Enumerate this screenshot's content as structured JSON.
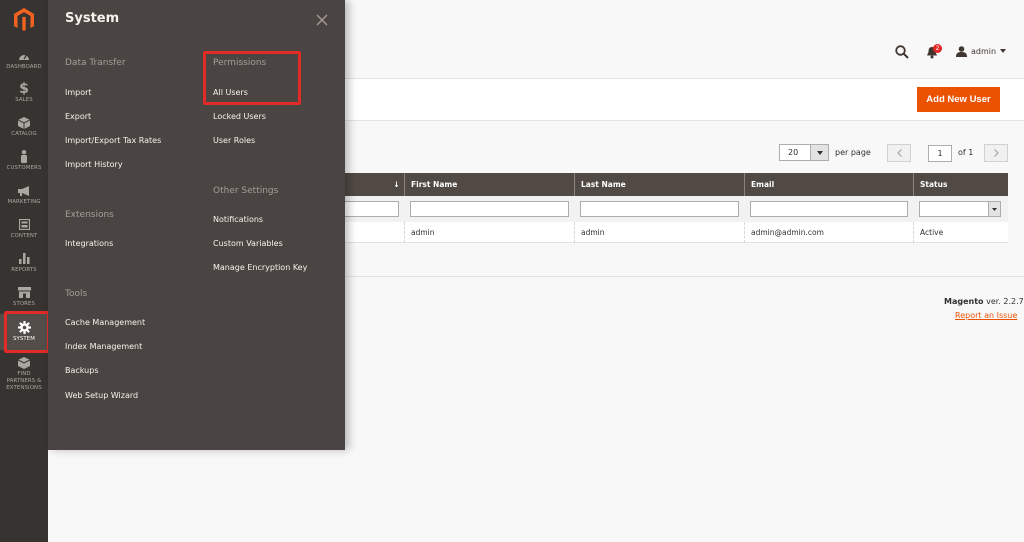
{
  "nav": {
    "items": [
      {
        "key": "dashboard",
        "label": "DASHBOARD",
        "icon": "dashboard-icon"
      },
      {
        "key": "sales",
        "label": "SALES",
        "icon": "dollar-icon"
      },
      {
        "key": "catalog",
        "label": "CATALOG",
        "icon": "cube-icon"
      },
      {
        "key": "customers",
        "label": "CUSTOMERS",
        "icon": "person-icon"
      },
      {
        "key": "marketing",
        "label": "MARKETING",
        "icon": "megaphone-icon"
      },
      {
        "key": "content",
        "label": "CONTENT",
        "icon": "layout-icon"
      },
      {
        "key": "reports",
        "label": "REPORTS",
        "icon": "bar-chart-icon"
      },
      {
        "key": "stores",
        "label": "STORES",
        "icon": "storefront-icon"
      },
      {
        "key": "system",
        "label": "SYSTEM",
        "icon": "gear-icon"
      },
      {
        "key": "partners",
        "label": "FIND PARTNERS & EXTENSIONS",
        "icon": "box-icon"
      }
    ],
    "dollar_glyph": "$"
  },
  "header": {
    "notification_count": "2",
    "user_name": "admin"
  },
  "action": {
    "add_new_user": "Add New User"
  },
  "pager": {
    "per_page_value": "20",
    "per_page_label": "per page",
    "current_page": "1",
    "of_label": "of 1"
  },
  "grid": {
    "sort_arrow": "↓",
    "columns": [
      "First Name",
      "Last Name",
      "Email",
      "Status"
    ],
    "rows": [
      {
        "first_name": "admin",
        "last_name": "admin",
        "email": "admin@admin.com",
        "status": "Active"
      }
    ]
  },
  "footer": {
    "brand": "Magento",
    "version": "ver. 2.2.7",
    "report_issue": "Report an Issue"
  },
  "panel": {
    "title": "System",
    "sections": {
      "data_transfer": {
        "title": "Data Transfer",
        "links": [
          "Import",
          "Export",
          "Import/Export Tax Rates",
          "Import History"
        ]
      },
      "extensions": {
        "title": "Extensions",
        "links": [
          "Integrations"
        ]
      },
      "tools": {
        "title": "Tools",
        "links": [
          "Cache Management",
          "Index Management",
          "Backups",
          "Web Setup Wizard"
        ]
      },
      "permissions": {
        "title": "Permissions",
        "links": [
          "All Users",
          "Locked Users",
          "User Roles"
        ]
      },
      "other_settings": {
        "title": "Other Settings",
        "links": [
          "Notifications",
          "Custom Variables",
          "Manage Encryption Key"
        ]
      }
    }
  },
  "colors": {
    "accent": "#eb5202",
    "nav_bg": "#373330",
    "panel_bg": "#4a4542",
    "highlight": "#e02b27",
    "grid_header": "#514943"
  }
}
